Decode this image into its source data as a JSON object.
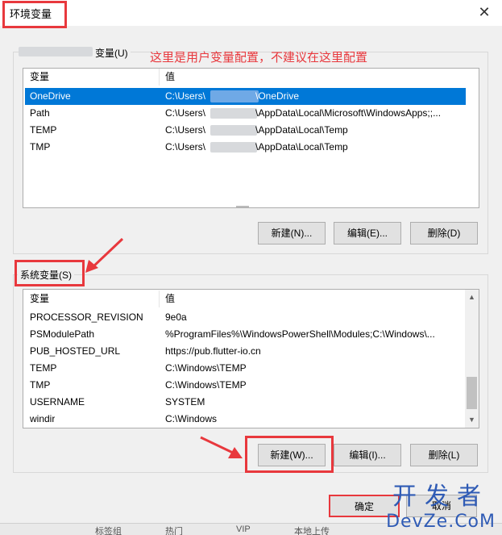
{
  "window": {
    "title": "环境变量",
    "close_glyph": "✕"
  },
  "user_group": {
    "label": "变量(U)",
    "annotation": "这里是用户变量配置，不建议在这里配置",
    "columns": [
      "变量",
      "值"
    ],
    "rows": [
      {
        "name": "OneDrive",
        "value_prefix": "C:\\Users\\",
        "value_suffix": "\\OneDrive",
        "selected": true
      },
      {
        "name": "Path",
        "value_prefix": "C:\\Users\\",
        "value_suffix": "\\AppData\\Local\\Microsoft\\WindowsApps;;...",
        "selected": false
      },
      {
        "name": "TEMP",
        "value_prefix": "C:\\Users\\",
        "value_suffix": "\\AppData\\Local\\Temp",
        "selected": false
      },
      {
        "name": "TMP",
        "value_prefix": "C:\\Users\\",
        "value_suffix": "\\AppData\\Local\\Temp",
        "selected": false
      }
    ],
    "buttons": {
      "new": "新建(N)...",
      "edit": "编辑(E)...",
      "delete": "删除(D)"
    }
  },
  "system_group": {
    "label": "系统变量(S)",
    "columns": [
      "变量",
      "值"
    ],
    "rows": [
      {
        "name": "PROCESSOR_REVISION",
        "value": "9e0a"
      },
      {
        "name": "PSModulePath",
        "value": "%ProgramFiles%\\WindowsPowerShell\\Modules;C:\\Windows\\..."
      },
      {
        "name": "PUB_HOSTED_URL",
        "value": "https://pub.flutter-io.cn"
      },
      {
        "name": "TEMP",
        "value": "C:\\Windows\\TEMP"
      },
      {
        "name": "TMP",
        "value": "C:\\Windows\\TEMP"
      },
      {
        "name": "USERNAME",
        "value": "SYSTEM"
      },
      {
        "name": "windir",
        "value": "C:\\Windows"
      }
    ],
    "buttons": {
      "new": "新建(W)...",
      "edit": "编辑(I)...",
      "delete": "删除(L)"
    }
  },
  "footer": {
    "ok": "确定",
    "cancel": "取消"
  },
  "bottom_strip": [
    "标签组",
    "热门",
    "VIP",
    "本地上传"
  ],
  "watermark": {
    "line1": "开发者",
    "line2": "DevZe.CoM"
  },
  "colors": {
    "accent": "#e8383d",
    "selection": "#0078d7",
    "watermark": "#2f5bb5"
  }
}
